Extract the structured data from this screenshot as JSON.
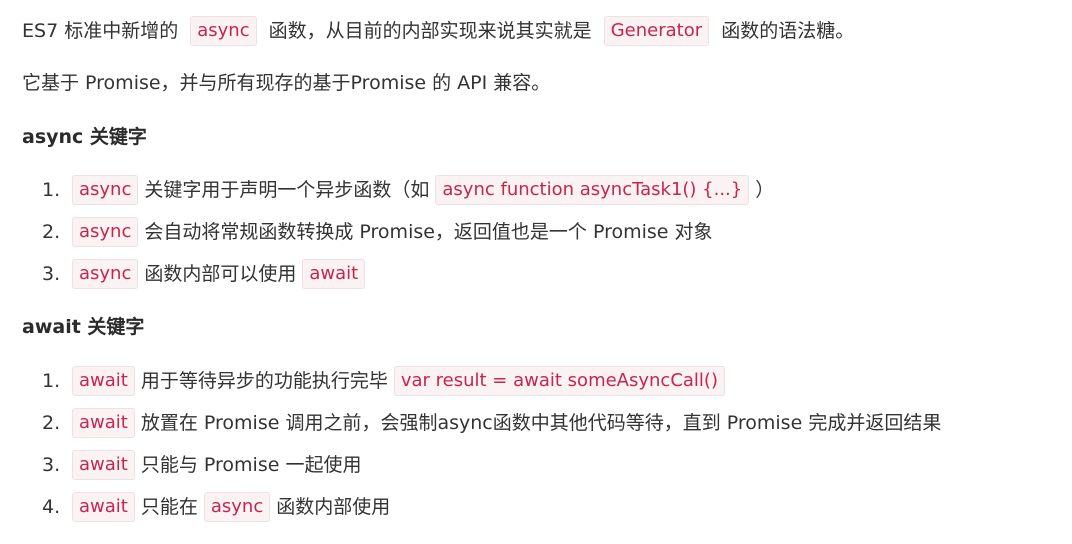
{
  "intro": {
    "line1": {
      "before": "ES7 标准中新增的",
      "code1": "async",
      "middle": "函数，从目前的内部实现来说其实就是",
      "code2": "Generator",
      "after": "函数的语法糖。"
    },
    "line2": "它基于 Promise，并与所有现存的基于Promise 的 API 兼容。"
  },
  "async_section": {
    "heading": "async 关键字",
    "items": [
      {
        "num": "1.",
        "code": "async",
        "text": "关键字用于声明一个异步函数（如",
        "code2": "async function asyncTask1() {...}",
        "after": "）"
      },
      {
        "num": "2.",
        "code": "async",
        "text": "会自动将常规函数转换成 Promise，返回值也是一个 Promise 对象"
      },
      {
        "num": "3.",
        "code": "async",
        "text": "函数内部可以使用",
        "code2": "await"
      }
    ]
  },
  "await_section": {
    "heading": "await 关键字",
    "items": [
      {
        "num": "1.",
        "code": "await",
        "text": "用于等待异步的功能执行完毕",
        "code2": "var result = await someAsyncCall()"
      },
      {
        "num": "2.",
        "code": "await",
        "text": "放置在 Promise 调用之前，会强制async函数中其他代码等待，直到 Promise 完成并返回结果"
      },
      {
        "num": "3.",
        "code": "await",
        "text": "只能与 Promise 一起使用"
      },
      {
        "num": "4.",
        "code": "await",
        "text": "只能在",
        "code2": "async",
        "after": "函数内部使用"
      }
    ]
  }
}
